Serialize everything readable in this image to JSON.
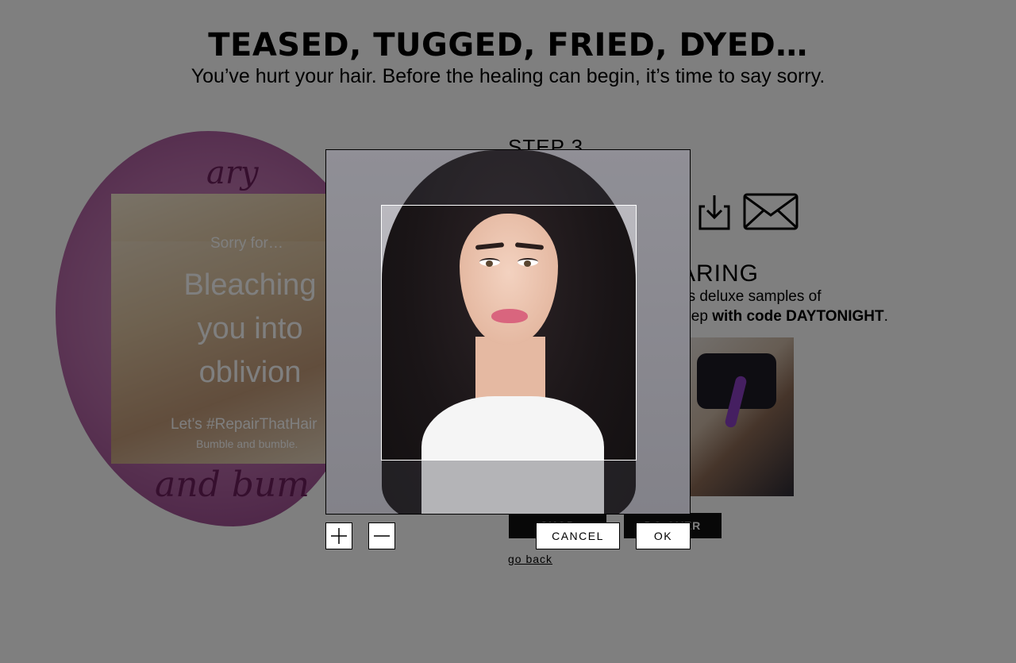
{
  "header": {
    "headline": "TEASED, TUGGED, FRIED, DYED…",
    "subline": "You’ve hurt your hair. Before the healing can begin, it’s time to say sorry."
  },
  "card": {
    "sorry_for": "Sorry for…",
    "apology": "Bleaching you into oblivion",
    "hashtag": "Let’s #RepairThatHair",
    "brand": "Bumble and bumble."
  },
  "step": {
    "label": "STEP 3",
    "share_icons": [
      "download-icon",
      "mail-icon"
    ],
    "caring_heading": "ARING",
    "promo_line1": "us deluxe samples of",
    "promo_line2_prefix": "leep ",
    "promo_line2_bold": "with code DAYTONIGHT",
    "promo_line2_suffix": "."
  },
  "actions": {
    "shop_label": "SHOP",
    "do_over_label": "DO OVER",
    "go_back_label": "go back"
  },
  "cropper": {
    "zoom_in_icon": "plus-icon",
    "zoom_out_icon": "minus-icon",
    "cancel_label": "CANCEL",
    "ok_label": "OK"
  },
  "colors": {
    "overlay": "rgba(0,0,0,0.5)",
    "rose": "#b76aa8",
    "button_dark": "#111111"
  }
}
